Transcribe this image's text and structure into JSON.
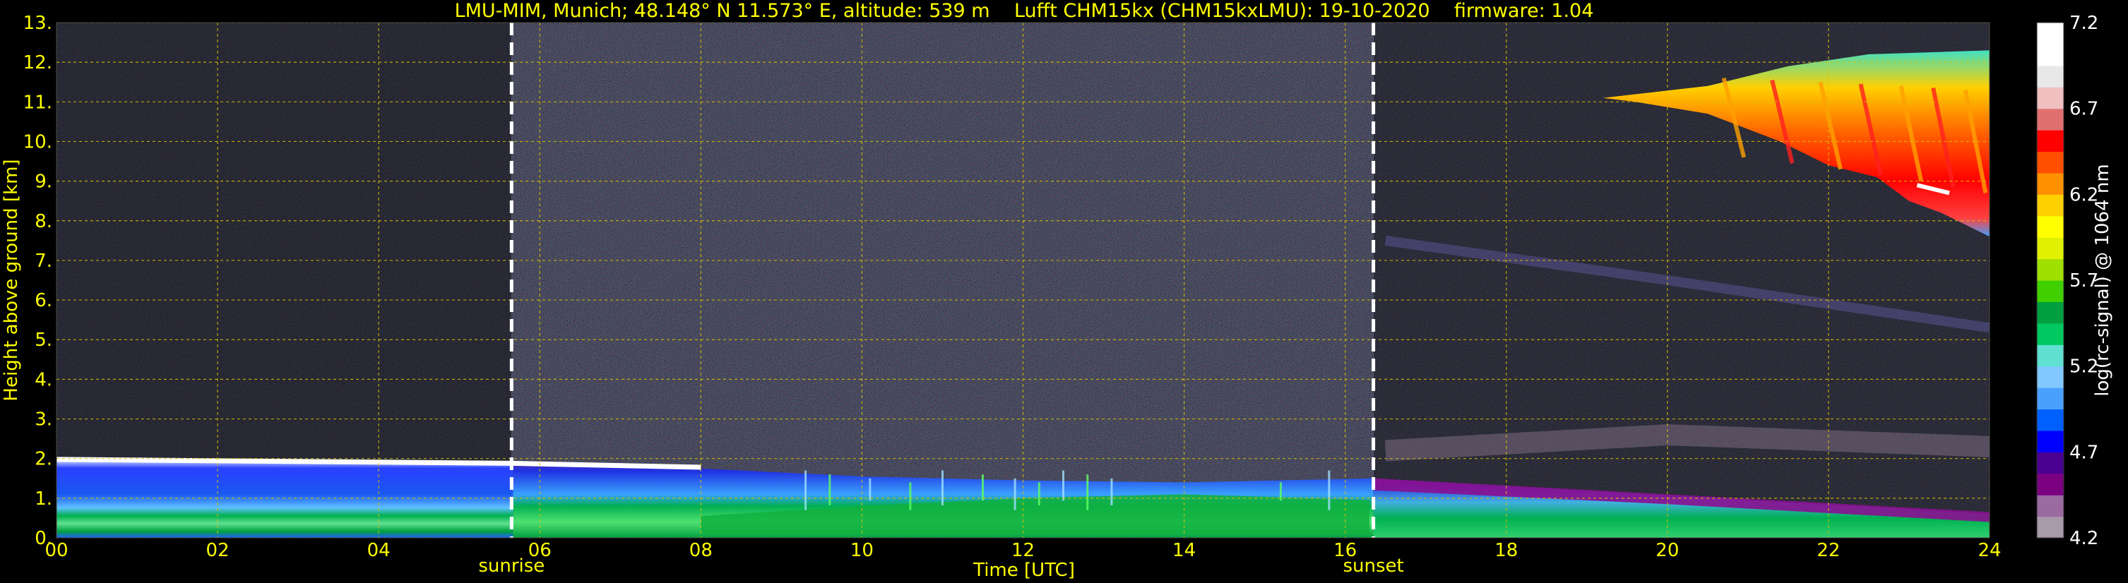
{
  "chart_data": {
    "type": "heatmap",
    "title": "LMU-MIM, Munich; 48.148° N 11.573° E, altitude: 539 m    Lufft CHM15kx (CHM15kxLMU): 19-10-2020    firmware: 1.04",
    "xlabel": "Time [UTC]",
    "ylabel": "Height above ground [km]",
    "x_ticks": [
      "00",
      "02",
      "04",
      "06",
      "08",
      "10",
      "12",
      "14",
      "16",
      "18",
      "20",
      "22",
      "24"
    ],
    "x_tick_values": [
      0,
      2,
      4,
      6,
      8,
      10,
      12,
      14,
      16,
      18,
      20,
      22,
      24
    ],
    "y_ticks": [
      "0.",
      "1.",
      "2.",
      "3.",
      "4.",
      "5.",
      "6.",
      "7.",
      "8.",
      "9.",
      "10.",
      "11.",
      "12.",
      "13."
    ],
    "y_tick_values": [
      0,
      1,
      2,
      3,
      4,
      5,
      6,
      7,
      8,
      9,
      10,
      11,
      12,
      13
    ],
    "xlim": [
      0,
      24
    ],
    "ylim": [
      0,
      13
    ],
    "grid": true,
    "annotations": [
      {
        "label": "sunrise",
        "x": 5.65
      },
      {
        "label": "sunset",
        "x": 16.35
      }
    ],
    "colorbar": {
      "label": "log(rc-signal) @ 1064 nm",
      "ticks": [
        "4.2",
        "4.7",
        "5.2",
        "5.7",
        "6.2",
        "6.7",
        "7.2"
      ],
      "tick_values": [
        4.2,
        4.7,
        5.2,
        5.7,
        6.2,
        6.7,
        7.2
      ],
      "range": [
        4.2,
        7.2
      ]
    },
    "features": [
      {
        "name": "boundary-layer-top",
        "x": [
          0,
          5.65,
          8,
          10,
          12,
          14,
          16.35,
          24
        ],
        "y": [
          2.0,
          1.85,
          1.75,
          1.55,
          1.45,
          1.4,
          1.5,
          0.6
        ]
      },
      {
        "name": "cirrus-cloud",
        "x_range": [
          19.2,
          24
        ],
        "y_range": [
          7.5,
          12.3
        ],
        "peak_value": 6.2
      }
    ]
  },
  "colors": {
    "background": "#000000",
    "text": "#ffff00",
    "grid": "#d8c000",
    "marker_line": "#ffffff",
    "colorbar_label": "#ffffff",
    "colormap": [
      "#a89aa8",
      "#9a6aa0",
      "#7a0080",
      "#4a0090",
      "#0000ff",
      "#0060ff",
      "#4aa0ff",
      "#80c8ff",
      "#60e0d0",
      "#00c860",
      "#00a040",
      "#40d000",
      "#a0e000",
      "#e0f000",
      "#ffff00",
      "#ffd000",
      "#ff9000",
      "#ff5000",
      "#ff0000",
      "#e07070",
      "#f0c0c0",
      "#e8e8e8",
      "#ffffff",
      "#ffffff"
    ]
  }
}
